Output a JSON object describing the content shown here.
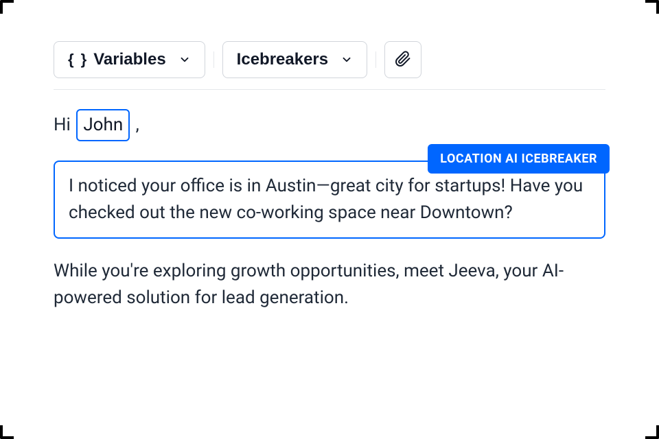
{
  "toolbar": {
    "variables_label": "Variables",
    "icebreakers_label": "Icebreakers"
  },
  "composer": {
    "greeting_prefix": "Hi ",
    "variable_name": "John",
    "greeting_suffix": " ,",
    "icebreaker_tag": "LOCATION AI ICEBREAKER",
    "icebreaker_body": "I noticed your office is in Austin—great city for startups! Have you checked out the new co-working space near Downtown?",
    "followup": "While you're exploring growth opportunities, meet Jeeva, your AI-powered solution for lead generation."
  }
}
